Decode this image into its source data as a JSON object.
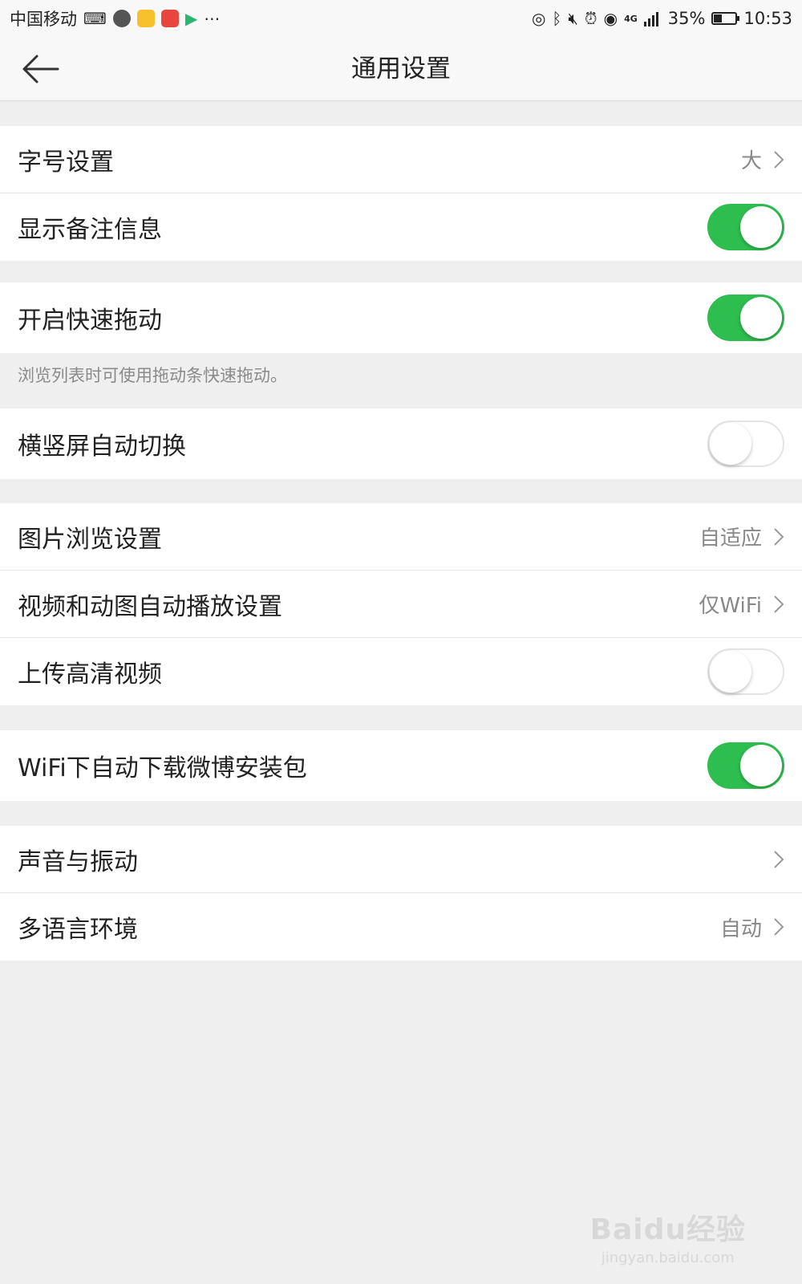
{
  "status_bar": {
    "carrier": "中国移动",
    "network": "4G",
    "battery": "35%",
    "battery_level": 0.35,
    "time": "10:53"
  },
  "header": {
    "title": "通用设置"
  },
  "settings": {
    "font_size": {
      "label": "字号设置",
      "value": "大"
    },
    "show_remarks": {
      "label": "显示备注信息",
      "on": true
    },
    "quick_drag": {
      "label": "开启快速拖动",
      "on": true
    },
    "quick_drag_hint": "浏览列表时可使用拖动条快速拖动。",
    "auto_rotate": {
      "label": "横竖屏自动切换",
      "on": false
    },
    "image_browse": {
      "label": "图片浏览设置",
      "value": "自适应"
    },
    "video_autoplay": {
      "label": "视频和动图自动播放设置",
      "value": "仅WiFi"
    },
    "hd_upload": {
      "label": "上传高清视频",
      "on": false
    },
    "wifi_download": {
      "label": "WiFi下自动下载微博安装包",
      "on": true
    },
    "sound_vibration": {
      "label": "声音与振动"
    },
    "language": {
      "label": "多语言环境",
      "value": "自动"
    }
  },
  "colors": {
    "toggle_on": "#2ebd4f",
    "background": "#efefef"
  },
  "watermark": {
    "brand": "Baidu经验",
    "url": "jingyan.baidu.com"
  }
}
